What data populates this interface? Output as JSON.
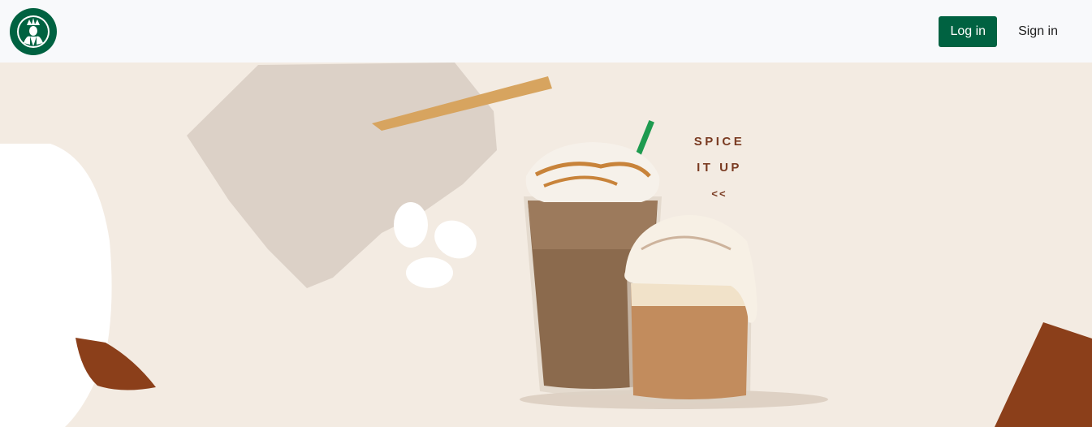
{
  "nav": {
    "logo_icon": "starbucks-siren-logo",
    "login_label": "Log in",
    "signin_label": "Sign in"
  },
  "hero": {
    "promo_line1": "SPICE",
    "promo_line2": "IT UP",
    "promo_arrow": "<<"
  },
  "colors": {
    "brand_green": "#006241",
    "hero_background": "#f3ebe2",
    "accent_rust": "#8b3f1a",
    "accent_tan": "#d7a45f"
  }
}
